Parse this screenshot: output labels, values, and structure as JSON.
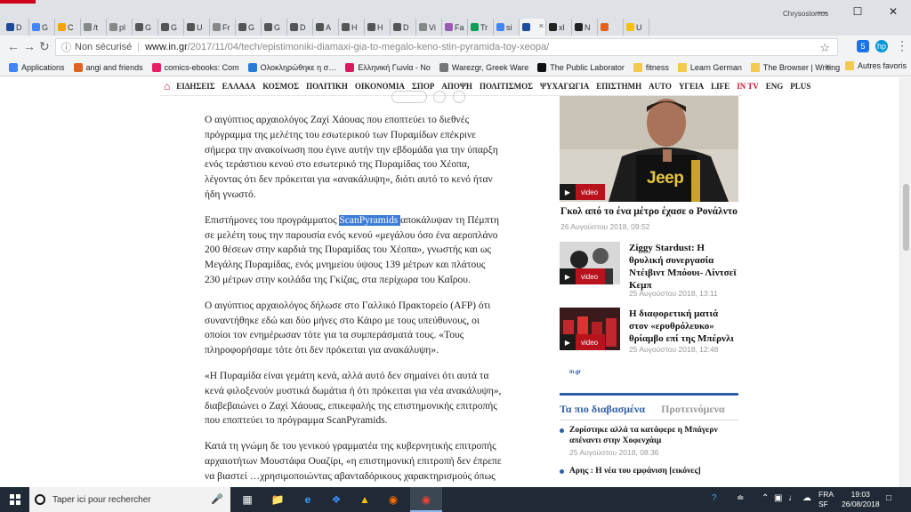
{
  "browser": {
    "tabs": [
      {
        "label": "D",
        "color": "#1e4c9a"
      },
      {
        "label": "G",
        "color": "#4285f4"
      },
      {
        "label": "C",
        "color": "#f4a300"
      },
      {
        "label": "/t",
        "color": "#888888"
      },
      {
        "label": "pl",
        "color": "#888888"
      },
      {
        "label": "G",
        "color": "#555555"
      },
      {
        "label": "G",
        "color": "#555555"
      },
      {
        "label": "U",
        "color": "#555555"
      },
      {
        "label": "Fr",
        "color": "#888888"
      },
      {
        "label": "G",
        "color": "#555555"
      },
      {
        "label": "G",
        "color": "#555555"
      },
      {
        "label": "D",
        "color": "#555555"
      },
      {
        "label": "A",
        "color": "#555555"
      },
      {
        "label": "H",
        "color": "#555555"
      },
      {
        "label": "H",
        "color": "#555555"
      },
      {
        "label": "D",
        "color": "#555555"
      },
      {
        "label": "Vi",
        "color": "#888888"
      },
      {
        "label": "Fa",
        "color": "#9b59b6"
      },
      {
        "label": "Tr",
        "color": "#0f9d58"
      },
      {
        "label": "si",
        "color": "#4285f4"
      },
      {
        "label": "",
        "color": "#1e4c9a",
        "active": true
      },
      {
        "label": "xl",
        "color": "#222222"
      },
      {
        "label": "N",
        "color": "#222222"
      },
      {
        "label": "",
        "color": "#e2621b"
      },
      {
        "label": "U",
        "color": "#f4c20d"
      }
    ],
    "profile_name": "Chrysostomos",
    "address": {
      "security_label": "Non sécurisé",
      "host": "www.in.gr",
      "path": "/2017/11/04/tech/epistimoniki-diamaxi-gia-to-megalo-keno-stin-pyramida-toy-xeopa/"
    },
    "bookmarks": [
      {
        "label": "Applications",
        "icon": "apps-grid-icon",
        "color": "#4285f4"
      },
      {
        "label": "angi and friends",
        "icon": "b-icon",
        "color": "#e2621b"
      },
      {
        "label": "comics-ebooks: Com",
        "icon": "doc-icon",
        "color": "#e91e63"
      },
      {
        "label": "Ολοκληρώθηκε η σ…",
        "icon": "ebay-icon",
        "color": "#2a7bd6"
      },
      {
        "label": "Ελληνική Γωνία - Νο",
        "icon": "star-icon",
        "color": "#d81b60"
      },
      {
        "label": "Warezgr, Greek Ware",
        "icon": "w-icon",
        "color": "#777777"
      },
      {
        "label": "The Public Laborator",
        "icon": "pl-icon",
        "color": "#111111"
      },
      {
        "label": "fitness",
        "icon": "folder-icon",
        "color": "#f3c94f",
        "folder": true
      },
      {
        "label": "Learn German",
        "icon": "folder-icon",
        "color": "#f3c94f",
        "folder": true
      },
      {
        "label": "The Browser | Writing",
        "icon": "folder-icon",
        "color": "#f3c94f",
        "folder": true
      }
    ],
    "bookmarks_more": "»",
    "other_bookmarks": "Autres favoris"
  },
  "site": {
    "nav": [
      "ΕΙΔΗΣΕΙΣ",
      "ΕΛΛΑΔΑ",
      "ΚΟΣΜΟΣ",
      "ΠΟΛΙΤΙΚΗ",
      "ΟΙΚΟΝΟΜΙΑ",
      "ΣΠΟΡ",
      "ΑΠΟΨΗ",
      "ΠΟΛΙΤΙΣΜΟΣ",
      "ΨΥΧΑΓΩΓΙΑ",
      "ΕΠΙΣΤΗΜΗ",
      "AUTO",
      "ΥΓΕΙΑ",
      "LIFE",
      "IN TV",
      "ENG",
      "PLUS"
    ],
    "nav_highlight": "IN TV"
  },
  "article": {
    "p1": "Ο αιγύπτιος αρχαιολόγος Ζαχί Χάουας που εποπτεύει το διεθνές πρόγραμμα της μελέτης του εσωτερικού των Πυραμίδων επέκρινε σήμερα την ανακοίνωση που έγινε αυτήν την εβδομάδα για την ύπαρξη ενός τεράστιου κενού στο εσωτερικό της Πυραμίδας του Χέοπα, λέγοντας ότι δεν πρόκειται για «ανακάλυψη», διότι αυτό το κενό ήταν ήδη γνωστό.",
    "p2_before": "Επιστήμονες του προγράμματος ",
    "p2_highlight": "ScanPyramids ",
    "p2_after": "αποκάλυψαν τη Πέμπτη σε μελέτη τους την παρουσία ενός κενού «μεγάλου όσο ένα αεροπλάνο 200 θέσεων στην καρδιά της Πυραμίδας του Χέοπα», γνωστής και ως Μεγάλης Πυραμίδας, ενός μνημείου ύψους 139 μέτρων και πλάτους 230 μέτρων στην κοιλάδα της Γκίζας, στα περίχωρα του Καΐρου.",
    "p3": "Ο αιγύπτιος αρχαιολόγος δήλωσε στο Γαλλικό Πρακτορείο (AFP) ότι συναντήθηκε εδώ και δύο μήνες στο Κάιρο με τους υπεύθυνους, οι οποίοι τον ενημέρωσαν τότε για τα συμπεράσματά τους. «Τους πληροφορήσαμε τότε ότι δεν πρόκειται για ανακάλυψη».",
    "p4": "«Η Πυραμίδα είναι γεμάτη κενά, αλλά αυτό δεν σημαίνει ότι αυτά τα κενά φιλοξενούν μυστικά δωμάτια ή ότι πρόκειται για νέα ανακάλυψη», διαβεβαιώνει ο Ζαχί Χάουας, επικεφαλής της επιστημονικής επιτροπής που εποπτεύει το πρόγραμμα ScanPyramids.",
    "p5": "Κατά τη γνώμη δε του γενικού γραμματέα της κυβερνητικής επιτροπής αρχαιοτήτων Μουστάφα Ουαζίρι, «η επιστημονική επιτροπή δεν έπρεπε να βιαστεί …χρησιμοποιώντας αβανταδόρικους χαρακτηρισμούς όπως"
  },
  "sidebar": {
    "video_label": "video",
    "big": {
      "title": "Γκολ από το ένα μέτρο έχασε ο Ρονάλντο",
      "date": "26 Αυγούστου 2018, 09:52",
      "shirt_text": "Jeep"
    },
    "cards": [
      {
        "title": "Ziggy Stardust: Η θρυλική συνεργασία Ντέιβιντ Μπόουι- Λίντσεϊ Κεμπ",
        "date": "25 Αυγούστου 2018, 13:11"
      },
      {
        "title": "Η διαφορετική ματιά στον «ερυθρόλευκο» θρίαμβο επί της Μπέρνλι",
        "date": "25 Αυγούστου 2018, 12:48"
      }
    ],
    "logo_text": "in.gr",
    "tabs": {
      "most_read": "Τα πιο διαβασμένα",
      "recommended": "Προτεινόμενα"
    },
    "most_read": [
      {
        "title": "Ζορίστηκε αλλά τα κατάφερε η Μπάγερν απέναντι στην Χοφενχάιμ",
        "date": "25 Αυγούστου 2018, 08:36"
      },
      {
        "title": "Αρης : Η νέα του εμφάνιση [εικόνες]",
        "date": ""
      }
    ]
  },
  "taskbar": {
    "search_placeholder": "Taper ici pour rechercher",
    "lang": "FRA",
    "lang_sub": "SF",
    "time": "19:03",
    "date": "26/08/2018"
  }
}
